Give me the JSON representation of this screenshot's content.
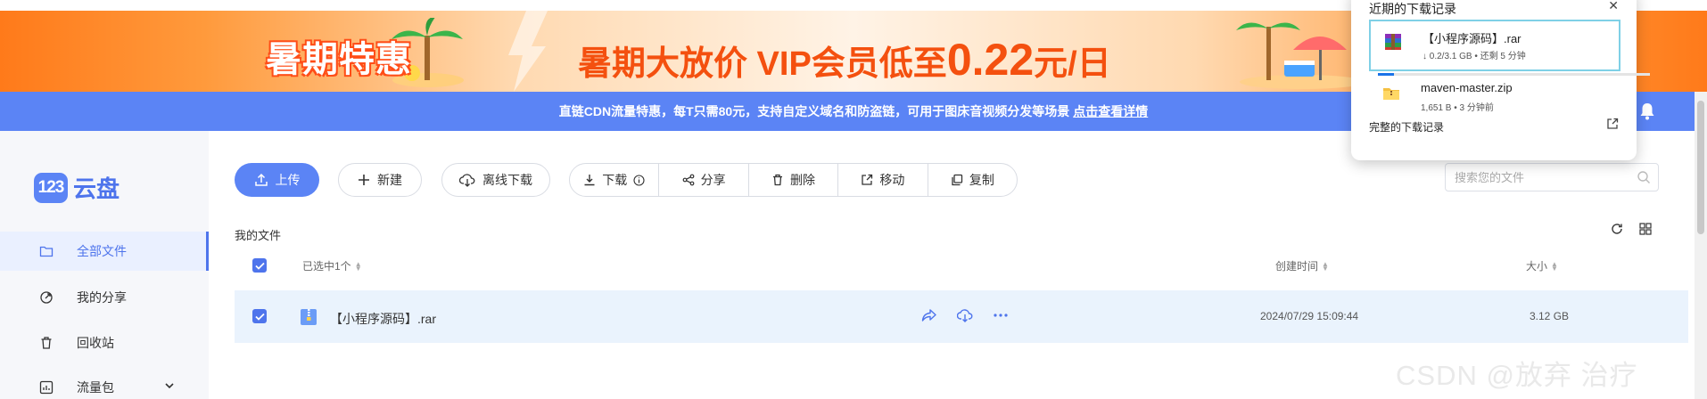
{
  "banner": {
    "tag": "暑期特惠",
    "headline": "暑期大放价  VIP会员低至",
    "price": "0.22",
    "unit": "元/日"
  },
  "notice": {
    "text": "直链CDN流量特惠，每T只需80元，支持自定义域名和防盗链，可用于图床音视频分发等场景",
    "link": "点击查看详情"
  },
  "logo": {
    "badge": "123",
    "text": "云盘"
  },
  "sidebar": {
    "items": [
      {
        "label": "全部文件",
        "icon": "folder-icon",
        "active": true
      },
      {
        "label": "我的分享",
        "icon": "share-link-icon"
      },
      {
        "label": "回收站",
        "icon": "trash-icon"
      },
      {
        "label": "流量包",
        "icon": "chart-icon",
        "expandable": true
      }
    ]
  },
  "toolbar": {
    "upload": "上传",
    "new": "新建",
    "offline": "离线下载",
    "download": "下载",
    "share": "分享",
    "delete": "删除",
    "move": "移动",
    "copy": "复制"
  },
  "search": {
    "placeholder": "搜索您的文件"
  },
  "list": {
    "breadcrumb": "我的文件",
    "header": {
      "selected": "已选中1个",
      "created": "创建时间",
      "size": "大小"
    },
    "rows": [
      {
        "name": "【小程序源码】.rar",
        "created": "2024/07/29 15:09:44",
        "size": "3.12 GB",
        "selected": true
      }
    ]
  },
  "downloads": {
    "title": "近期的下载记录",
    "items": [
      {
        "name": "【小程序源码】.rar",
        "meta": "↓ 0.2/3.1 GB • 还剩 5 分钟",
        "progress": 0.06,
        "icon": "rar-archive-icon"
      },
      {
        "name": "maven-master.zip",
        "meta": "1,651 B • 3 分钟前",
        "icon": "zip-folder-icon"
      }
    ],
    "all_link": "完整的下载记录"
  },
  "colors": {
    "accent": "#5b84f5",
    "banner_text": "#f4500f",
    "row_selected": "#eaf3fd"
  },
  "watermark": "CSDN @放弃      治疗"
}
